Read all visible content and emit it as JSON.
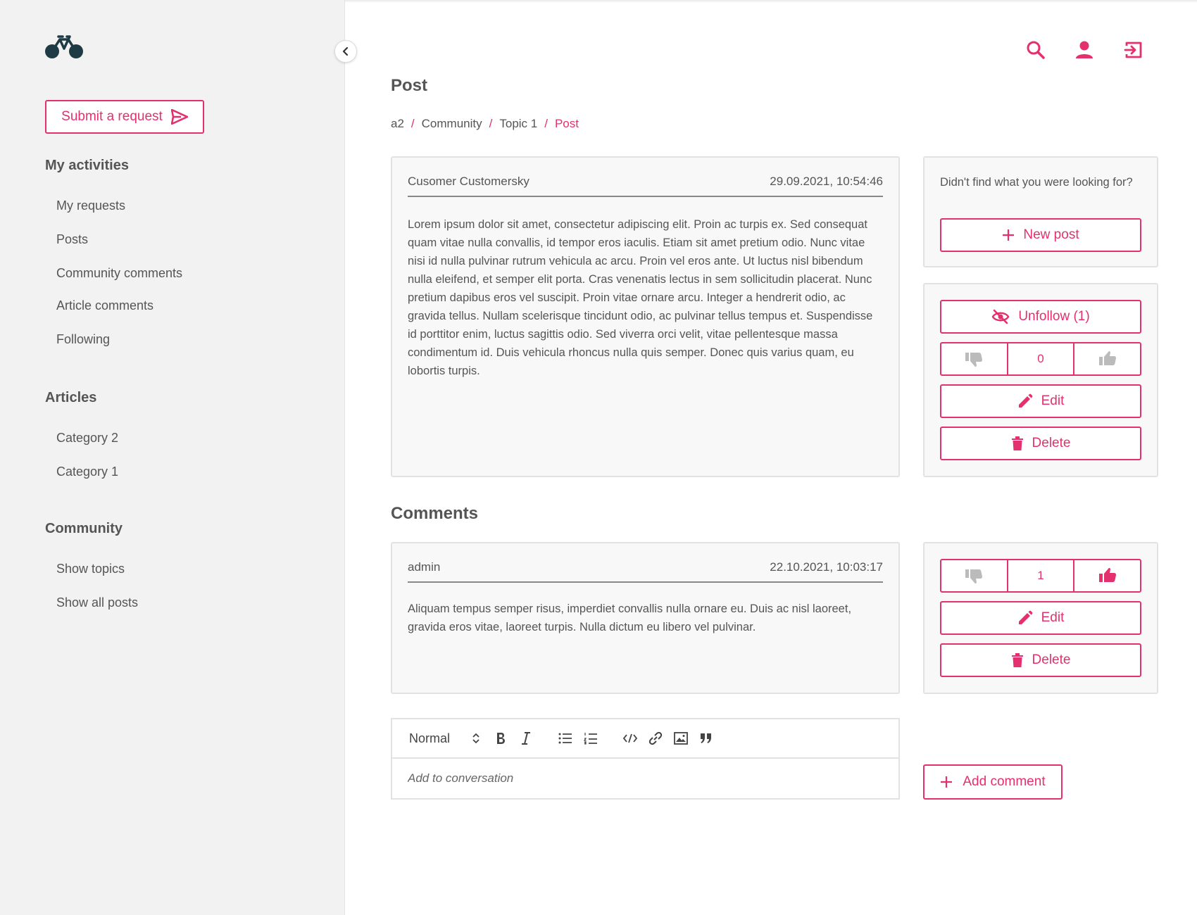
{
  "sidebar": {
    "submit_label": "Submit a request",
    "sections": [
      {
        "title": "My activities",
        "items": [
          "My requests",
          "Posts",
          "Community comments",
          "Article comments",
          "Following"
        ]
      },
      {
        "title": "Articles",
        "items": [
          "Category 2",
          "Category 1"
        ]
      },
      {
        "title": "Community",
        "items": [
          "Show topics",
          "Show all posts"
        ]
      }
    ]
  },
  "page": {
    "title": "Post",
    "breadcrumb": [
      "a2",
      "Community",
      "Topic 1",
      "Post"
    ],
    "breadcrumb_sep": "/"
  },
  "post": {
    "author": "Cusomer Customersky",
    "date": "29.09.2021, 10:54:46",
    "body": "Lorem ipsum dolor sit amet, consectetur adipiscing elit. Proin ac turpis ex. Sed consequat quam vitae nulla convallis, id tempor eros iaculis. Etiam sit amet pretium odio. Nunc vitae nisi id nulla pulvinar rutrum vehicula ac arcu. Proin vel eros ante. Ut luctus nisl bibendum nulla eleifend, et semper elit porta. Cras venenatis lectus in sem sollicitudin placerat. Nunc pretium dapibus eros vel suscipit. Proin vitae ornare arcu. Integer a hendrerit odio, ac gravida tellus. Nullam scelerisque tincidunt odio, ac pulvinar tellus tempus et. Suspendisse id porttitor enim, luctus sagittis odio. Sed viverra orci velit, vitae pellentesque massa condimentum id. Duis vehicula rhoncus nulla quis semper. Donec quis varius quam, eu lobortis turpis.",
    "votes": "0",
    "unfollow_label": "Unfollow (1)",
    "edit_label": "Edit",
    "delete_label": "Delete"
  },
  "help": {
    "text": "Didn't find what you were looking for?",
    "new_post_label": "New post"
  },
  "comments": {
    "title": "Comments",
    "items": [
      {
        "author": "admin",
        "date": "22.10.2021, 10:03:17",
        "body": "Aliquam tempus semper risus, imperdiet convallis nulla ornare eu. Duis ac nisl laoreet, gravida eros vitae, laoreet turpis. Nulla dictum eu libero vel pulvinar.",
        "votes": "1",
        "edit_label": "Edit",
        "delete_label": "Delete"
      }
    ]
  },
  "editor": {
    "format_value": "Normal",
    "placeholder": "Add to conversation",
    "add_comment_label": "Add comment"
  },
  "colors": {
    "accent": "#e4306e",
    "muted": "#bbbbbb",
    "sidebar_bg": "#f2f2f2"
  }
}
